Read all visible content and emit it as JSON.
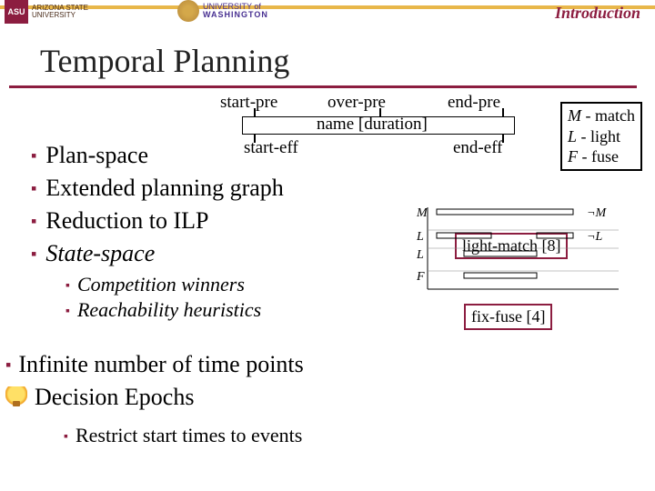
{
  "header": {
    "section_label": "Introduction",
    "asu_badge": "ASU",
    "asu_text1": "ARIZONA STATE",
    "asu_text2": "UNIVERSITY",
    "uw_text1": "UNIVERSITY of",
    "uw_text2": "WASHINGTON"
  },
  "title": "Temporal Planning",
  "list1": {
    "i0": "Plan-space",
    "i1": "Extended planning graph",
    "i2": "Reduction to ILP",
    "i3": "State-space"
  },
  "list2": {
    "i0": "Competition winners",
    "i1": "Reachability heuristics"
  },
  "list_top": {
    "i0": "Infinite number of time points",
    "i1": "Decision Epochs"
  },
  "list3": {
    "i0": "Restrict start times to events"
  },
  "diagram": {
    "pre1": "start-pre",
    "pre2": "over-pre",
    "pre3": "end-pre",
    "name": "name [duration]",
    "eff1": "start-eff",
    "eff2": "end-eff"
  },
  "legend": {
    "l1a": "M",
    "l1b": " - match",
    "l2a": "L",
    "l2b": "  - light",
    "l3a": "F",
    "l3b": "  - fuse"
  },
  "callouts": {
    "c1": "light-match [8]",
    "c2": "fix-fuse [4]"
  },
  "plot_labels": {
    "M": "M",
    "L": "L",
    "F": "F",
    "notL": "¬L",
    "notM": "¬M"
  }
}
